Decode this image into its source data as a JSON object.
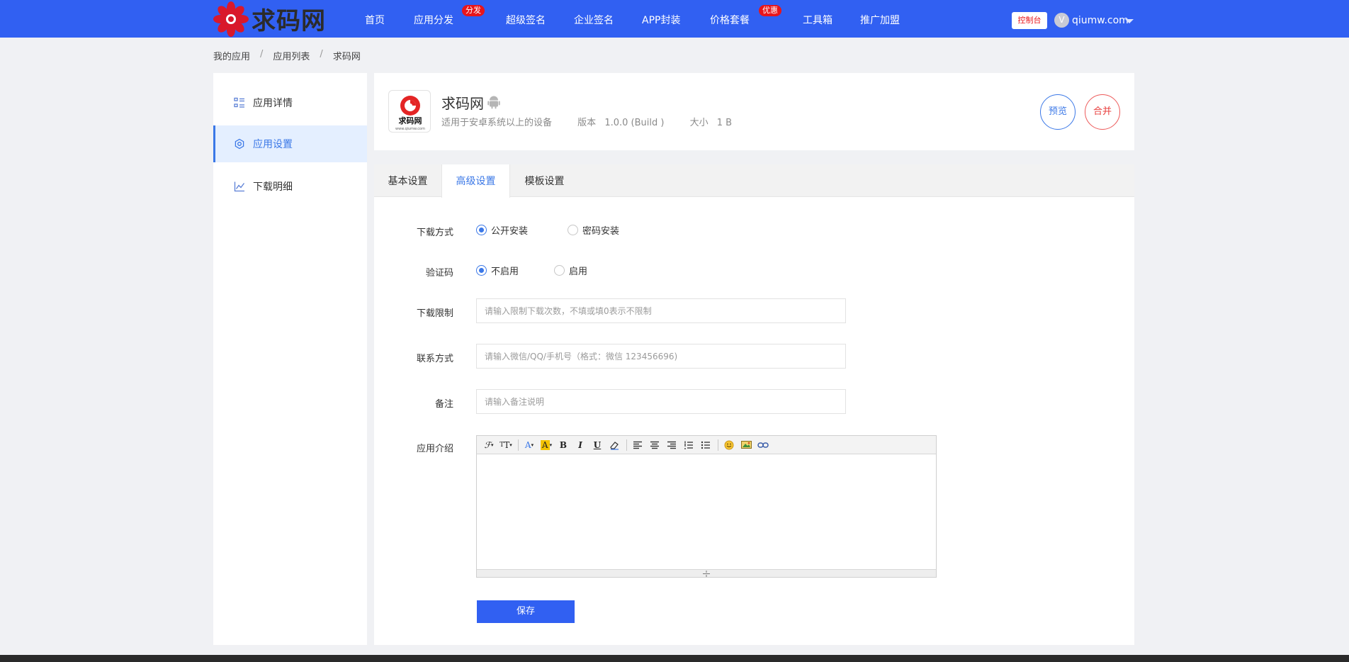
{
  "header": {
    "logo_text": "求码网",
    "nav": [
      {
        "label": "首页"
      },
      {
        "label": "应用分发",
        "badge": "分发"
      },
      {
        "label": "超级签名"
      },
      {
        "label": "企业签名"
      },
      {
        "label": "APP封装"
      },
      {
        "label": "价格套餐",
        "badge": "优惠"
      },
      {
        "label": "工具箱"
      },
      {
        "label": "推广加盟"
      }
    ],
    "console_label": "控制台",
    "avatar_letter": "V",
    "username": "qiumw.com",
    "bar_color": "#3160f2",
    "badge_color": "#e8151b"
  },
  "breadcrumb": [
    "我的应用",
    "应用列表",
    "求码网"
  ],
  "breadcrumb_separator": "/",
  "sidebar": {
    "items": [
      {
        "label": "应用详情",
        "icon": "list-icon",
        "active": false
      },
      {
        "label": "应用设置",
        "icon": "gear-icon",
        "active": true
      },
      {
        "label": "下载明细",
        "icon": "chart-icon",
        "active": false
      }
    ]
  },
  "app": {
    "name": "求码网",
    "icon_text": "求码网",
    "icon_subtext": "www.qiumw.com",
    "platform_icon": "android-icon",
    "compat": "适用于安卓系统以上的设备",
    "version_label": "版本",
    "version": "1.0.0 (Build )",
    "size_label": "大小",
    "size": "1 B",
    "preview_label": "预览",
    "merge_label": "合并"
  },
  "tabs": [
    {
      "label": "基本设置",
      "active": false
    },
    {
      "label": "高级设置",
      "active": true
    },
    {
      "label": "模板设置",
      "active": false
    }
  ],
  "form": {
    "download_mode": {
      "label": "下载方式",
      "options": [
        {
          "label": "公开安装",
          "checked": true
        },
        {
          "label": "密码安装",
          "checked": false
        }
      ]
    },
    "captcha": {
      "label": "验证码",
      "options": [
        {
          "label": "不启用",
          "checked": true
        },
        {
          "label": "启用",
          "checked": false
        }
      ]
    },
    "download_limit": {
      "label": "下载限制",
      "value": "",
      "placeholder": "请输入限制下载次数，不填或填0表示不限制"
    },
    "contact": {
      "label": "联系方式",
      "value": "",
      "placeholder": "请输入微信/QQ/手机号（格式：微信 123456696)"
    },
    "remark": {
      "label": "备注",
      "value": "",
      "placeholder": "请输入备注说明"
    },
    "intro": {
      "label": "应用介绍",
      "toolbar": [
        "font-family-icon",
        "font-size-icon",
        "font-color-icon",
        "highlight-color-icon",
        "bold-icon",
        "italic-icon",
        "underline-icon",
        "eraser-icon",
        "align-left-icon",
        "align-center-icon",
        "align-right-icon",
        "ordered-list-icon",
        "unordered-list-icon",
        "emoji-icon",
        "image-icon",
        "link-icon"
      ],
      "content": ""
    },
    "save_label": "保存"
  },
  "colors": {
    "accent": "#3b78e7",
    "danger": "#e8403f",
    "page_bg": "#f0f1f4"
  }
}
